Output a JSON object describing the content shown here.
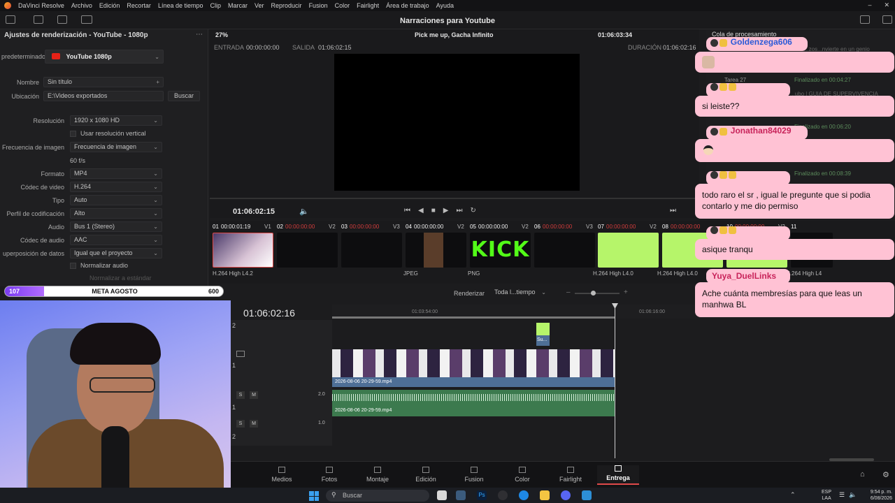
{
  "menubar": {
    "items": [
      "DaVinci Resolve",
      "Archivo",
      "Edición",
      "Recortar",
      "Línea de tiempo",
      "Clip",
      "Marcar",
      "Ver",
      "Reproducir",
      "Fusion",
      "Color",
      "Fairlight",
      "Área de trabajo",
      "Ayuda"
    ]
  },
  "toolbar": {
    "project_title": "Narraciones para Youtube"
  },
  "render_settings": {
    "title": "Ajustes de renderización - YouTube - 1080p",
    "preset_label": "predeterminado",
    "preset_value": "YouTube 1080p",
    "name_label": "Nombre",
    "name_value": "Sin título",
    "location_label": "Ubicación",
    "location_value": "E:\\Videos exportados",
    "browse_button": "Buscar",
    "resolution_label": "Resolución",
    "resolution_value": "1920 x 1080 HD",
    "vertical_res": "Usar resolución vertical",
    "framerate_label": "Frecuencia de imagen",
    "framerate_value": "Frecuencia de imagen",
    "fps": "60 f/s",
    "format_label": "Formato",
    "format_value": "MP4",
    "codec_label": "Códec de video",
    "codec_value": "H.264",
    "type_label": "Tipo",
    "type_value": "Auto",
    "profile_label": "Perfil de codificación",
    "profile_value": "Alto",
    "audio_label": "Audio",
    "audio_value": "Bus 1 (Stereo)",
    "audio_codec_label": "Códec de audio",
    "audio_codec_value": "AAC",
    "overlay_label": "uperposición de datos",
    "overlay_value": "Igual que el proyecto",
    "normalize": "Normalizar audio",
    "normalize_std": "Normalizar a estándar"
  },
  "viewer": {
    "zoom": "27%",
    "clip_name": "Pick me up, Gacha Infinito",
    "top_timecode": "01:06:03:34",
    "in_label": "ENTRADA",
    "in_value": "00:00:00:00",
    "out_label": "SALIDA",
    "out_value": "01:06:02:15",
    "duration_label": "DURACIÓN",
    "duration_value": "01:06:02:16",
    "current_tc": "01:06:02:15"
  },
  "clips": [
    {
      "num": "01",
      "tc": "00:00:01:19",
      "track": "V1",
      "codec": "H.264 High L4.2"
    },
    {
      "num": "02",
      "tc": "00:00:00:00",
      "track": "V2",
      "codec": ""
    },
    {
      "num": "03",
      "tc": "00:00:00:00",
      "track": "V3",
      "codec": ""
    },
    {
      "num": "04",
      "tc": "00:00:00:00",
      "track": "V2",
      "codec": "JPEG"
    },
    {
      "num": "05",
      "tc": "00:00:00:00",
      "track": "V2",
      "codec": "PNG",
      "thumb_text": "KICK"
    },
    {
      "num": "06",
      "tc": "00:00:00:00",
      "track": "V3",
      "codec": ""
    },
    {
      "num": "07",
      "tc": "00:00:00:00",
      "track": "V2",
      "codec": "H.264 High L4.0"
    },
    {
      "num": "08",
      "tc": "00:00:00:00",
      "track": "",
      "codec": "H.264 High L4.0"
    },
    {
      "num": "10",
      "tc": "00:00:00:00",
      "track": "V2",
      "codec": "H.264 High L4.0"
    },
    {
      "num": "11",
      "tc": "",
      "track": "",
      "codec": "H.264 High L4"
    }
  ],
  "goal": {
    "start": "107",
    "label": "META AGOSTO",
    "end": "600",
    "progress_fraction": 0.178
  },
  "timeline": {
    "render_label": "Renderizar",
    "render_value": "Toda l...tiempo",
    "timecode": "01:06:02:16",
    "ruler_a": "01:03:54:00",
    "ruler_b": "01:06:16:00",
    "video_clip": "2026-08-06 20-29-59.mp4",
    "audio_clip": "2026-08-06 20-29-59.mp4",
    "small_clip": "Su...",
    "a1_level": "2.0",
    "a2_level": "1.0",
    "track_v2": "2",
    "track_v1": "1",
    "track_a1": "1",
    "track_a2": "2"
  },
  "pagenav": {
    "items": [
      {
        "label": "Medios",
        "icon": "media-icon"
      },
      {
        "label": "Fotos",
        "icon": "camera-icon"
      },
      {
        "label": "Montaje",
        "icon": "cut-icon"
      },
      {
        "label": "Edición",
        "icon": "edit-icon"
      },
      {
        "label": "Fusion",
        "icon": "fusion-icon"
      },
      {
        "label": "Color",
        "icon": "color-icon"
      },
      {
        "label": "Fairlight",
        "icon": "music-icon"
      },
      {
        "label": "Entrega",
        "icon": "deliver-icon"
      }
    ],
    "active": "Entrega"
  },
  "queue": {
    "title": "Cola de procesamiento",
    "task": "Tarea 27",
    "done1": "Finalizado en 00:04:27",
    "done2": "Finalizado en 00:06:20",
    "done3": "Finalizado en 00:08:39",
    "frag1": "...zos...nvierte en un genio",
    "frag2": "...ubo | GUIA DE SUPERVIVENCIA"
  },
  "chat": [
    {
      "user": "Goldenzega606",
      "user_color": "#2a5ad8",
      "message": "",
      "emote": "cat"
    },
    {
      "user": "",
      "user_color": "#e04a8a",
      "message": "si leiste??",
      "emote": ""
    },
    {
      "user": "Jonathan84029",
      "user_color": "#c8235a",
      "message": "",
      "emote": "face"
    },
    {
      "user": "",
      "user_color": "#e04a8a",
      "message": "todo raro el sr , igual le pregunte que si podia contarlo y me dio permiso",
      "emote": ""
    },
    {
      "user": "",
      "user_color": "#e04a8a",
      "message": "asique tranqu",
      "emote": ""
    },
    {
      "user": "Yuya_DuelLinks",
      "user_color": "#c8235a",
      "message": "Ache cuánta membresías para que leas un manhwa BL",
      "emote": ""
    }
  ],
  "taskbar": {
    "search_placeholder": "Buscar",
    "lang": "ESP",
    "lang2": "LAA",
    "time": "9:54 p. m.",
    "date": "6/08/2026"
  }
}
